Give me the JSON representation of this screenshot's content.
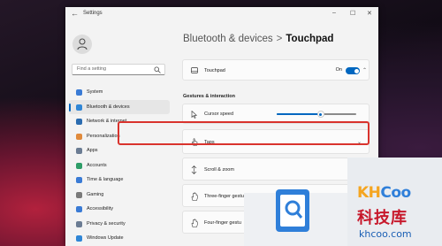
{
  "window": {
    "title": "Settings",
    "back": "←",
    "minimize": "–",
    "maximize": "☐",
    "close": "✕"
  },
  "sidebar": {
    "search_placeholder": "Find a setting",
    "items": [
      {
        "label": "System",
        "icon": "monitor-icon",
        "color": "#3a7bd5"
      },
      {
        "label": "Bluetooth & devices",
        "icon": "bluetooth-icon",
        "color": "#2f86d6",
        "active": true
      },
      {
        "label": "Network & internet",
        "icon": "wifi-icon",
        "color": "#2b6cb0"
      },
      {
        "label": "Personalization",
        "icon": "brush-icon",
        "color": "#e08a3c"
      },
      {
        "label": "Apps",
        "icon": "apps-icon",
        "color": "#6b7c93"
      },
      {
        "label": "Accounts",
        "icon": "person-icon",
        "color": "#2e9d68"
      },
      {
        "label": "Time & language",
        "icon": "globe-clock-icon",
        "color": "#3a7bd5"
      },
      {
        "label": "Gaming",
        "icon": "gamepad-icon",
        "color": "#7a7a7a"
      },
      {
        "label": "Accessibility",
        "icon": "accessibility-icon",
        "color": "#3a7bd5"
      },
      {
        "label": "Privacy & security",
        "icon": "shield-icon",
        "color": "#6b7c93"
      },
      {
        "label": "Windows Update",
        "icon": "update-icon",
        "color": "#2f86d6"
      }
    ]
  },
  "main": {
    "breadcrumb": {
      "parent": "Bluetooth & devices",
      "separator": ">",
      "current": "Touchpad"
    },
    "touchpad": {
      "label": "Touchpad",
      "toggle_text": "On",
      "toggle_on": true
    },
    "section_title": "Gestures & interaction",
    "cursor_speed": {
      "label": "Cursor speed",
      "value": 0.55
    },
    "taps": {
      "label": "Taps"
    },
    "scroll_zoom": {
      "label": "Scroll & zoom"
    },
    "three_finger": {
      "label": "Three-finger gestu"
    },
    "four_finger": {
      "label": "Four-finger gestu"
    }
  },
  "watermark": {
    "brand_a": "KH",
    "brand_b": "Coo",
    "cn": "科技库",
    "url": "khcoo.com"
  }
}
